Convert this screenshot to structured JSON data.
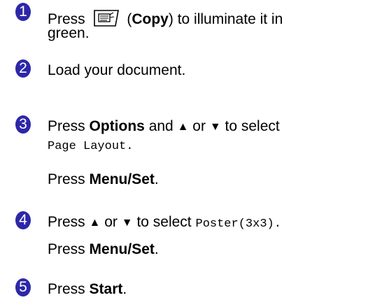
{
  "steps": [
    {
      "number": "1",
      "line1_prefix": "Press",
      "line1_bold": "Copy",
      "line1_suffix": "to illuminate it in",
      "line2": "green.",
      "key_icon": "copy-key-icon"
    },
    {
      "number": "2",
      "line1": "Load your document."
    },
    {
      "number": "3",
      "press": "Press",
      "options": "Options",
      "and": "and",
      "up": "▲",
      "or": "or",
      "down": "▼",
      "to_select": "to select",
      "setting": "Page Layout.",
      "press2": "Press",
      "menu_set": "Menu/Set",
      "period": "."
    },
    {
      "number": "4",
      "press": "Press",
      "up": "▲",
      "or": "or",
      "down": "▼",
      "to_select": "to select",
      "setting": "Poster(3x3).",
      "press2": "Press",
      "menu_set": "Menu/Set",
      "period": "."
    },
    {
      "number": "5",
      "press": "Press",
      "start": "Start",
      "period": "."
    }
  ],
  "colors": {
    "badge": "#2d27a8"
  }
}
